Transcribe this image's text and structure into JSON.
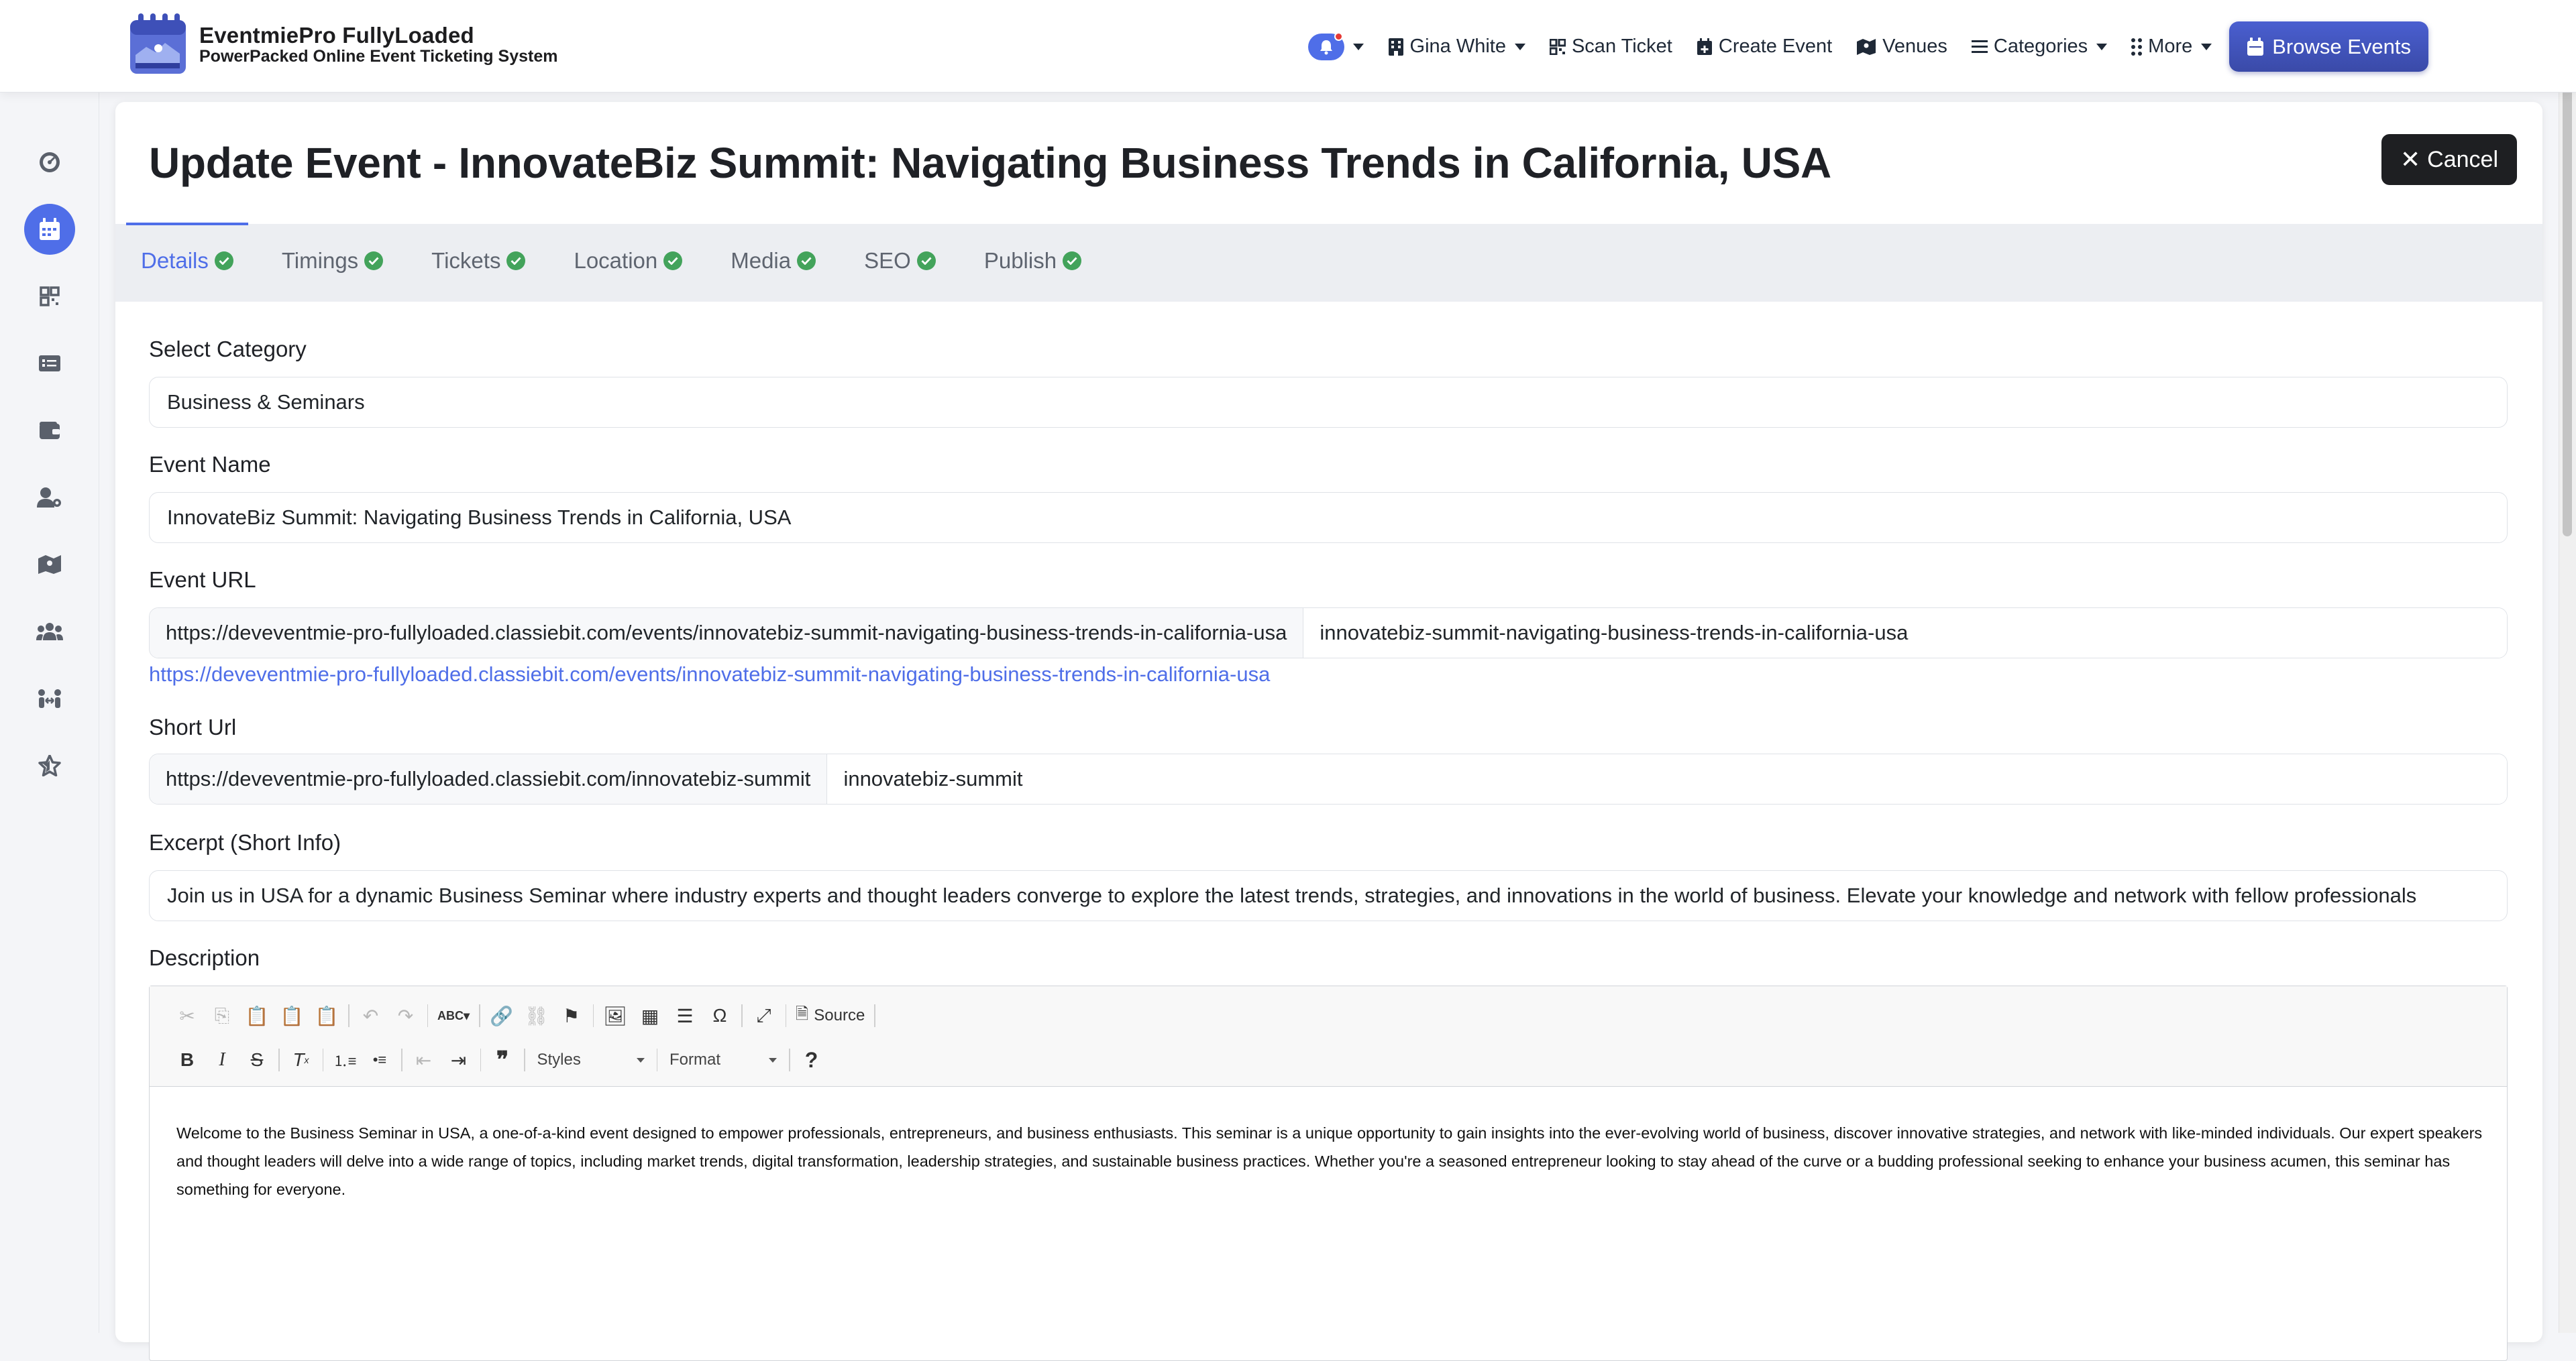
{
  "brand": {
    "title": "EventmiePro FullyLoaded",
    "subtitle": "PowerPacked Online Event Ticketing System"
  },
  "nav": {
    "user": "Gina White",
    "scan_ticket": "Scan Ticket",
    "create_event": "Create Event",
    "venues": "Venues",
    "categories": "Categories",
    "more": "More",
    "browse_events": "Browse Events"
  },
  "page": {
    "title": "Update Event - InnovateBiz Summit: Navigating Business Trends in California, USA",
    "cancel": "Cancel"
  },
  "tabs": [
    "Details",
    "Timings",
    "Tickets",
    "Location",
    "Media",
    "SEO",
    "Publish"
  ],
  "form": {
    "category_label": "Select Category",
    "category_value": "Business & Seminars",
    "name_label": "Event Name",
    "name_value": "InnovateBiz Summit: Navigating Business Trends in California, USA",
    "url_label": "Event URL",
    "url_prefix": "https://deveventmie-pro-fullyloaded.classiebit.com/events/innovatebiz-summit-navigating-business-trends-in-california-usa",
    "url_slug": "innovatebiz-summit-navigating-business-trends-in-california-usa",
    "url_link": "https://deveventmie-pro-fullyloaded.classiebit.com/events/innovatebiz-summit-navigating-business-trends-in-california-usa",
    "short_label": "Short Url",
    "short_prefix": "https://deveventmie-pro-fullyloaded.classiebit.com/innovatebiz-summit",
    "short_slug": "innovatebiz-summit",
    "excerpt_label": "Excerpt (Short Info)",
    "excerpt_value": "Join us in USA for a dynamic Business Seminar where industry experts and thought leaders converge to explore the latest trends, strategies, and innovations in the world of business. Elevate your knowledge and network with fellow professionals",
    "description_label": "Description"
  },
  "editor": {
    "source": "Source",
    "styles": "Styles",
    "format": "Format",
    "text": "Welcome to the Business Seminar in USA, a one-of-a-kind event designed to empower professionals, entrepreneurs, and business enthusiasts. This seminar is a unique opportunity to gain insights into the ever-evolving world of business, discover innovative strategies, and network with like-minded individuals. Our expert speakers and thought leaders will delve into a wide range of topics, including market trends, digital transformation, leadership strategies, and sustainable business practices. Whether you're a seasoned entrepreneur looking to stay ahead of the curve or a budding professional seeking to enhance your business acumen, this seminar has something for everyone."
  },
  "colors": {
    "accent": "#4f6ee8",
    "success": "#43a35b",
    "dark_button": "#1e1f22"
  }
}
